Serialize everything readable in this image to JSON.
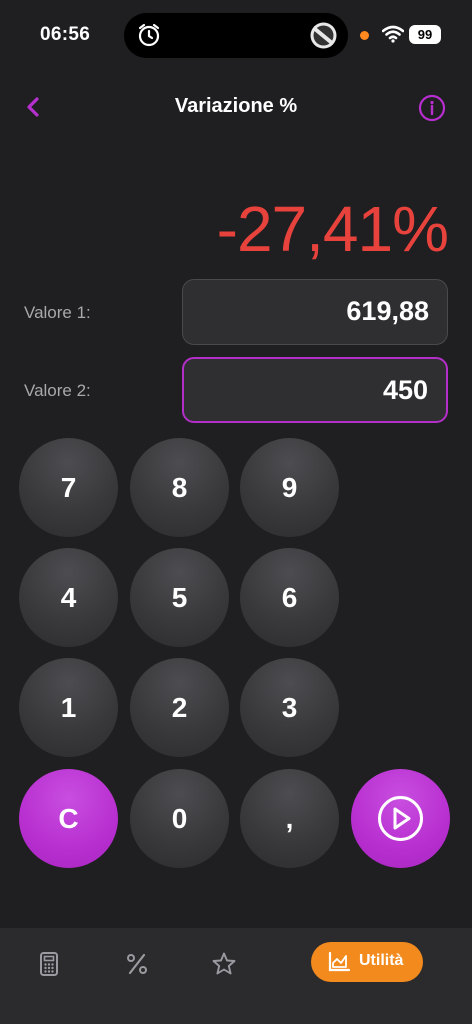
{
  "status_bar": {
    "time": "06:56",
    "battery": "99"
  },
  "header": {
    "title": "Variazione %"
  },
  "result": "-27,41%",
  "fields": [
    {
      "label": "Valore 1:",
      "value": "619,88"
    },
    {
      "label": "Valore 2:",
      "value": "450"
    }
  ],
  "keypad": {
    "keys": [
      "7",
      "8",
      "9",
      "4",
      "5",
      "6",
      "1",
      "2",
      "3",
      "C",
      "0",
      ","
    ]
  },
  "tabbar": {
    "active_label": "Utilità"
  },
  "colors": {
    "accent": "#b82fd0",
    "result": "#e8423d",
    "tab_active": "#f28a1d",
    "background": "#1f1f21"
  }
}
